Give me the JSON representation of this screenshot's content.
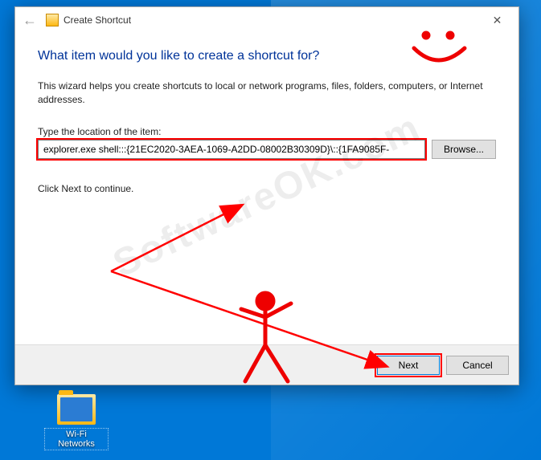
{
  "dialog": {
    "title": "Create Shortcut",
    "heading": "What item would you like to create a shortcut for?",
    "description": "This wizard helps you create shortcuts to local or network programs, files, folders, computers, or Internet addresses.",
    "location_label": "Type the location of the item:",
    "location_value": "explorer.exe shell:::{21EC2020-3AEA-1069-A2DD-08002B30309D}\\::{1FA9085F-",
    "browse": "Browse...",
    "hint": "Click Next to continue.",
    "next": "Next",
    "cancel": "Cancel"
  },
  "desktop": {
    "shortcut_name": "Wi-Fi Networks"
  },
  "watermark": "SoftwareOK.com"
}
